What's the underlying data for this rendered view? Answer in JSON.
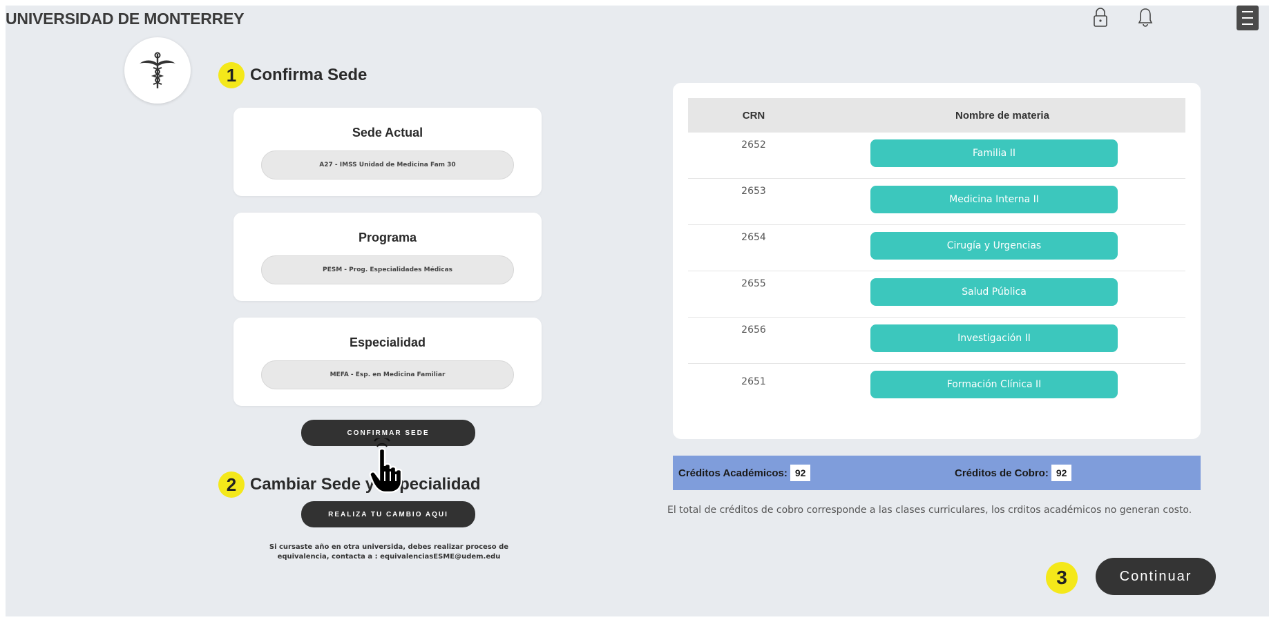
{
  "header": {
    "brand": "UNIVERSIDAD DE MONTERREY",
    "icons": [
      "lock-icon",
      "bell-icon",
      "menu-icon"
    ]
  },
  "steps": {
    "one": {
      "number": "1",
      "title": "Confirma Sede"
    },
    "two": {
      "number": "2",
      "title": "Cambiar Sede y Especialidad"
    },
    "three": {
      "number": "3"
    }
  },
  "cards": [
    {
      "title": "Sede Actual",
      "value": "A27 - IMSS Unidad de Medicina Fam 30"
    },
    {
      "title": "Programa",
      "value": "PESM - Prog. Especialidades Médicas"
    },
    {
      "title": "Especialidad",
      "value": "MEFA - Esp. en Medicina Familiar"
    }
  ],
  "buttons": {
    "confirm": "CONFIRMAR SEDE",
    "change": "REALIZA TU CAMBIO AQUI",
    "continue": "Continuar"
  },
  "note": "Si cursaste año en otra universida, debes realizar proceso de equivalencia, contacta a : equivalenciasESME@udem.edu",
  "table": {
    "headers": {
      "crn": "CRN",
      "name": "Nombre de materia"
    },
    "rows": [
      {
        "crn": "2652",
        "name": "Familia II"
      },
      {
        "crn": "2653",
        "name": "Medicina Interna II"
      },
      {
        "crn": "2654",
        "name": "Cirugía y Urgencias"
      },
      {
        "crn": "2655",
        "name": "Salud Pública"
      },
      {
        "crn": "2656",
        "name": "Investigación II"
      },
      {
        "crn": "2651",
        "name": "Formación Clínica II"
      }
    ]
  },
  "credits": {
    "academic_label": "Créditos Académicos:",
    "academic_value": "92",
    "billing_label": "Créditos de Cobro:",
    "billing_value": "92"
  },
  "footnote": "El total de créditos de cobro corresponde a las clases curriculares, los crditos académicos no generan costo.",
  "colors": {
    "teal": "#3cc7bd",
    "credits_bar": "#7f9ddb",
    "step_badge": "#f4e81a",
    "dark_button": "#323232"
  }
}
